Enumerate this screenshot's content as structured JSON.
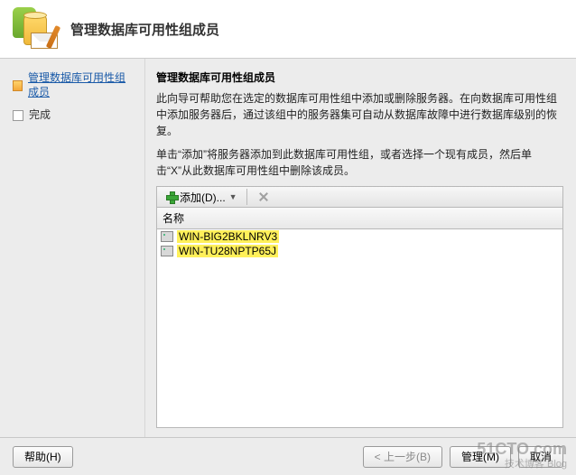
{
  "header": {
    "title": "管理数据库可用性组成员"
  },
  "sidebar": {
    "steps": [
      {
        "label": "管理数据库可用性组成员",
        "active": true
      },
      {
        "label": "完成",
        "active": false
      }
    ]
  },
  "main": {
    "section_title": "管理数据库可用性组成员",
    "desc1": "此向导可帮助您在选定的数据库可用性组中添加或删除服务器。在向数据库可用性组中添加服务器后，通过该组中的服务器集可自动从数据库故障中进行数据库级别的恢复。",
    "desc2": "单击“添加”将服务器添加到此数据库可用性组，或者选择一个现有成员，然后单击“X”从此数据库可用性组中删除该成员。",
    "toolbar": {
      "add_label": "添加(D)..."
    },
    "list": {
      "column_header": "名称",
      "items": [
        {
          "name": "WIN-BIG2BKLNRV3"
        },
        {
          "name": "WIN-TU28NPTP65J"
        }
      ]
    }
  },
  "footer": {
    "help": "帮助(H)",
    "back": "< 上一步(B)",
    "manage": "管理(M)",
    "cancel": "取消"
  },
  "watermark": {
    "main": "51CTO.com",
    "sub": "技术博客  Blog"
  }
}
